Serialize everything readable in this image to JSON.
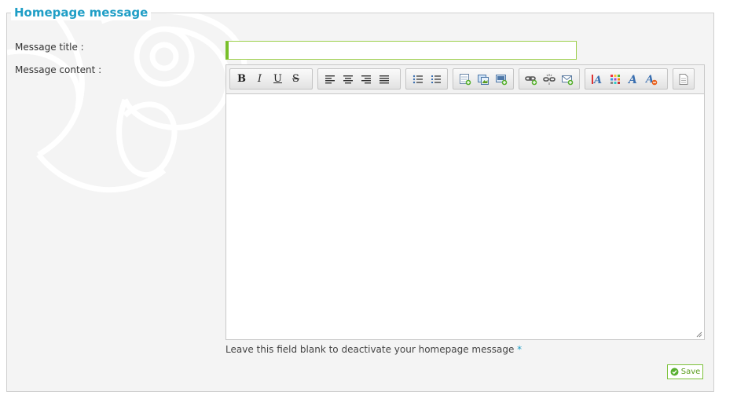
{
  "section": {
    "legend": "Homepage message"
  },
  "form": {
    "title_label": "Message title :",
    "title_value": "",
    "content_label": "Message content :",
    "content_value": "",
    "help_text": "Leave this field blank to deactivate your homepage message",
    "help_star": "*",
    "save_label": "Save"
  },
  "toolbar": {
    "bold": "B",
    "italic": "I",
    "underline": "U",
    "strike": "S"
  },
  "colors": {
    "accent": "#1f9ec6",
    "input_border": "#78bf2a",
    "save_green": "#5a9c1d"
  }
}
